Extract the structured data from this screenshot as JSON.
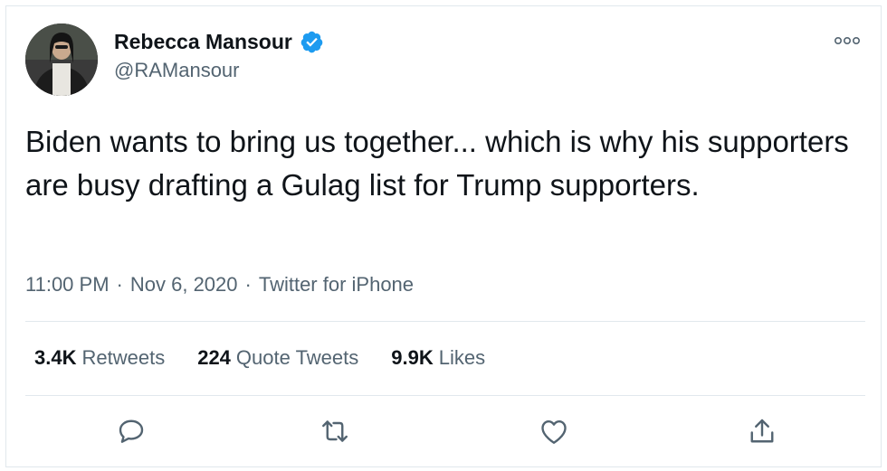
{
  "author": {
    "name": "Rebecca Mansour",
    "handle": "@RAMansour",
    "verified": true
  },
  "tweet": {
    "text": "Biden wants to bring us together... which is why his supporters are busy drafting a Gulag list for Trump supporters.",
    "time": "11:00 PM",
    "date": "Nov 6, 2020",
    "source": "Twitter for iPhone",
    "separator": "·"
  },
  "stats": {
    "retweets_count": "3.4K",
    "retweets_label": "Retweets",
    "quotes_count": "224",
    "quotes_label": "Quote Tweets",
    "likes_count": "9.9K",
    "likes_label": "Likes"
  },
  "icons": {
    "reply": "reply-icon",
    "retweet": "retweet-icon",
    "like": "heart-icon",
    "share": "share-icon",
    "more": "more-options-icon",
    "verified": "verified-badge-icon"
  },
  "colors": {
    "text_primary": "#0f1419",
    "text_secondary": "#536471",
    "verified": "#1d9bf0",
    "divider": "#e1e8ed"
  }
}
